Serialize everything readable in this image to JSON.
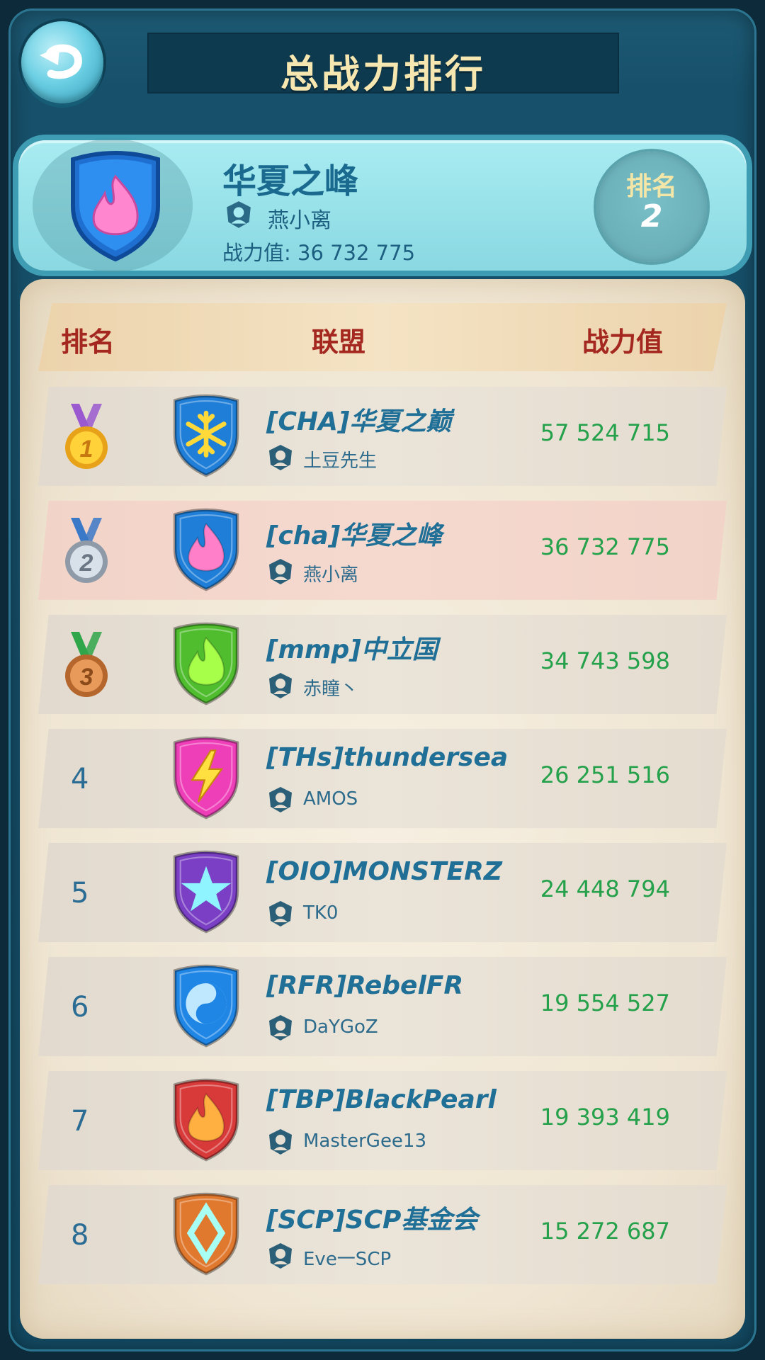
{
  "title": "总战力排行",
  "my_alliance": {
    "name": "华夏之峰",
    "leader": "燕小离",
    "power_text": "战力值: 36 732 775",
    "rank_label": "排名",
    "rank_value": "2",
    "emblem_icon": "fire-shield-icon"
  },
  "table": {
    "headers": {
      "rank": "排名",
      "alliance": "联盟",
      "power": "战力值"
    },
    "rows": [
      {
        "rank": "1",
        "name": "[CHA]华夏之巅",
        "leader": "土豆先生",
        "power": "57 524 715",
        "emblem": "snowflake",
        "shield": "#1f7fd8",
        "glyph": "#ffd93a",
        "medal": "gold",
        "me": false
      },
      {
        "rank": "2",
        "name": "[cha]华夏之峰",
        "leader": "燕小离",
        "power": "36 732 775",
        "emblem": "fire",
        "shield": "#1f7fd8",
        "glyph": "#ff7fc8",
        "medal": "silver",
        "me": true
      },
      {
        "rank": "3",
        "name": "[mmp]中立国",
        "leader": "赤瞳丶",
        "power": "34 743 598",
        "emblem": "fire",
        "shield": "#4fbd2e",
        "glyph": "#a8ff4a",
        "medal": "bronze",
        "me": false
      },
      {
        "rank": "4",
        "name": "[THs]thundersea",
        "leader": "AMOS",
        "power": "26 251 516",
        "emblem": "lightning",
        "shield": "#ee3fb8",
        "glyph": "#ffe040",
        "medal": "",
        "me": false
      },
      {
        "rank": "5",
        "name": "[OIO]MONSTERZ",
        "leader": "TK0",
        "power": "24 448 794",
        "emblem": "star",
        "shield": "#7a3fc4",
        "glyph": "#8ff4ff",
        "medal": "",
        "me": false
      },
      {
        "rank": "6",
        "name": "[RFR]RebelFR",
        "leader": "DaYGoZ",
        "power": "19 554 527",
        "emblem": "yinyang",
        "shield": "#1f86e6",
        "glyph": "#bfe8ff",
        "medal": "",
        "me": false
      },
      {
        "rank": "7",
        "name": "[TBP]BlackPearl",
        "leader": "MasterGee13",
        "power": "19 393 419",
        "emblem": "fire",
        "shield": "#d83a3a",
        "glyph": "#ffb040",
        "medal": "",
        "me": false
      },
      {
        "rank": "8",
        "name": "[SCP]SCP基金会",
        "leader": "Eve一SCP",
        "power": "15 272 687",
        "emblem": "diamond",
        "shield": "#e0782e",
        "glyph": "#a8fff4",
        "medal": "",
        "me": false
      }
    ]
  },
  "colors": {
    "title": "#f6e7b0",
    "header_text": "#a4281f",
    "name": "#1f6f96",
    "power": "#24a14a",
    "highlight_row": "#f2d3c8"
  }
}
